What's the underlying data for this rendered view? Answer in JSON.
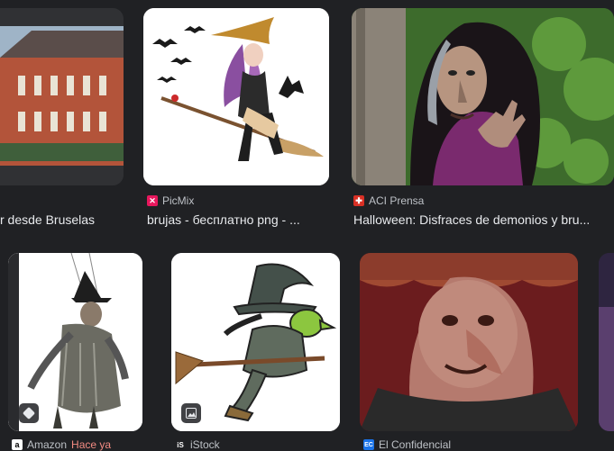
{
  "results": [
    {
      "source": "",
      "title": "r desde Bruselas",
      "fav_color": "#5f6368",
      "fav_glyph": ""
    },
    {
      "source": "PicMix",
      "title": "brujas - бесплатно png - ...",
      "fav_color": "#e8175d",
      "fav_glyph": "✕"
    },
    {
      "source": "ACI Prensa",
      "title": "Halloween: Disfraces de demonios y bru...",
      "fav_color": "#d93025",
      "fav_glyph": "✚"
    },
    {
      "source": "Amazon",
      "source_extra": "Hace ya",
      "fav_color": "#ffffff",
      "fav_glyph": "a"
    },
    {
      "source": "iStock",
      "fav_color": "#202124",
      "fav_glyph": "iS"
    },
    {
      "source": "El Confidencial",
      "fav_color": "#1a73e8",
      "fav_glyph": "EC"
    }
  ],
  "colors": {
    "background": "#202124",
    "text": "#e8eaed",
    "muted": "#bdc1c6",
    "link_orange": "#f28b82"
  },
  "icons": {
    "image_badge": "image-icon",
    "tag_badge": "tag-icon"
  }
}
